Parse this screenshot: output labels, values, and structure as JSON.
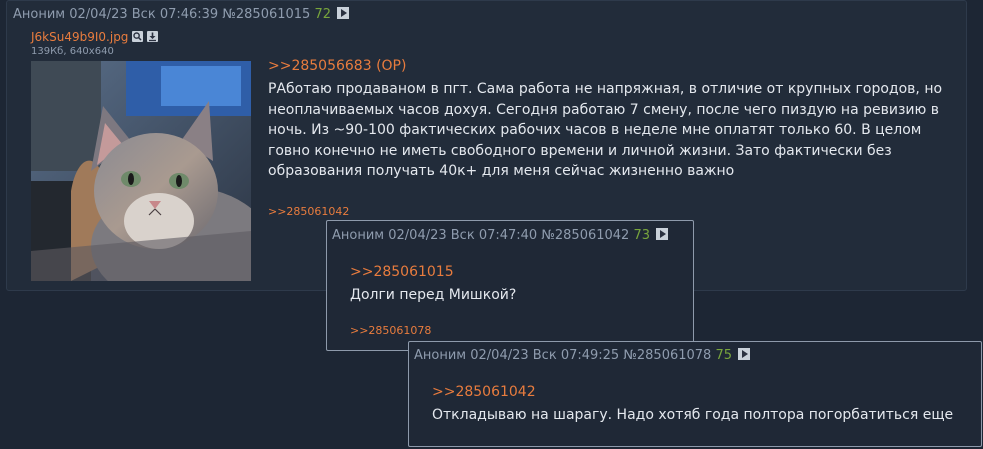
{
  "op": {
    "author": "Аноним",
    "date": "02/04/23 Вск 07:46:39",
    "number": "№285061015",
    "index": "72",
    "file": {
      "name": "J6kSu49b9I0.jpg",
      "meta": "139Кб, 640x640"
    },
    "reply_to": ">>285056683 (OP)",
    "text": "РАботаю продаваном в пгт. Сама работа не напряжная, в отличие от крупных городов, но неоплачиваемых часов дохуя. Сегодня работаю 7 смену, после чего пиздую на ревизию в ночь. Из ~90-100 фактических рабочих часов в неделе мне оплатят только 60. В целом говно конечно не иметь свободного времени и личной жизни. Зато фактически без образования получать 40к+ для меня сейчас жизненно важно",
    "replies": ">>285061042"
  },
  "popup1": {
    "author": "Аноним",
    "date": "02/04/23 Вск 07:47:40",
    "number": "№285061042",
    "index": "73",
    "reply_to": ">>285061015",
    "text": "Долги перед Мишкой?",
    "replies": ">>285061078"
  },
  "popup2": {
    "author": "Аноним",
    "date": "02/04/23 Вск 07:49:25",
    "number": "№285061078",
    "index": "75",
    "reply_to": ">>285061042",
    "text": "Откладываю на шарагу. Надо хотяб года полтора погорбатиться еще"
  },
  "icons": {
    "play": "play-icon",
    "search": "search-icon",
    "download": "download-icon"
  },
  "colors": {
    "link": "#e87c3e",
    "index": "#78a53c",
    "background": "#1d2634"
  }
}
